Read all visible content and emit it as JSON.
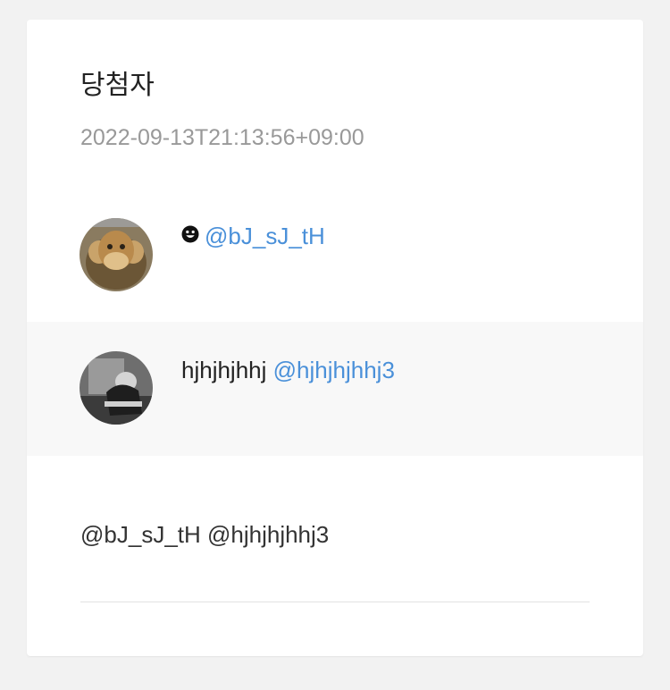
{
  "post": {
    "title": "당첨자",
    "timestamp": "2022-09-13T21:13:56+09:00"
  },
  "winners": [
    {
      "display_name": "",
      "status_icon": "smiley-face-icon",
      "handle": "@bJ_sJ_tH",
      "avatar": "stuffed-monkey-toy-photo"
    },
    {
      "display_name": "hjhjhjhhj",
      "handle": "@hjhjhjhhj3",
      "avatar": "grayscale-person-photo"
    }
  ],
  "mentions": "@bJ_sJ_tH @hjhjhjhhj3",
  "colors": {
    "page_background": "#f2f2f2",
    "card_background": "#ffffff",
    "alt_row_background": "#f8f8f8",
    "handle_link": "#4a90d9",
    "timestamp": "#999999"
  }
}
